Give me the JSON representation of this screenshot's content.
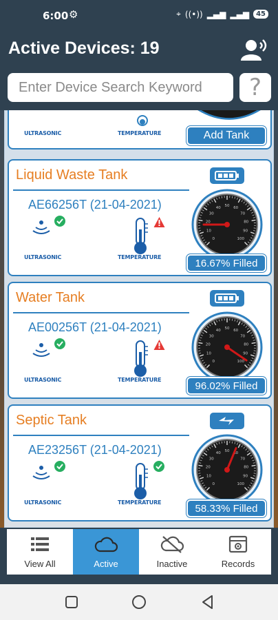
{
  "status_bar": {
    "time": "6:00",
    "battery": "45"
  },
  "header": {
    "title": "Active Devices: 19"
  },
  "search": {
    "placeholder": "Enter Device Search Keyword",
    "help_glyph": "?"
  },
  "sensor_labels": {
    "ultrasonic": "ULTRASONIC",
    "temperature": "TEMPERATURE"
  },
  "partial_card": {
    "button_label": "Add Tank"
  },
  "tanks": [
    {
      "name": "Liquid Waste Tank",
      "device_id": "AE66256T (21-04-2021)",
      "fill_label": "16.67% Filled",
      "fill_percent": 16.67,
      "ultrasonic_status": "ok",
      "temperature_status": "alert",
      "battery": "full"
    },
    {
      "name": "Water Tank",
      "device_id": "AE00256T (21-04-2021)",
      "fill_label": "96.02% Filled",
      "fill_percent": 96.02,
      "ultrasonic_status": "ok",
      "temperature_status": "alert",
      "battery": "full"
    },
    {
      "name": "Septic Tank",
      "device_id": "AE23256T (21-04-2021)",
      "fill_label": "58.33% Filled",
      "fill_percent": 58.33,
      "ultrasonic_status": "ok",
      "temperature_status": "ok",
      "battery": "charging"
    }
  ],
  "bottom_nav": [
    {
      "label": "View All",
      "icon": "list-icon",
      "active": false
    },
    {
      "label": "Active",
      "icon": "cloud-icon",
      "active": true
    },
    {
      "label": "Inactive",
      "icon": "cloud-off-icon",
      "active": false
    },
    {
      "label": "Records",
      "icon": "records-icon",
      "active": false
    }
  ],
  "colors": {
    "accent": "#2e80bf",
    "title_orange": "#e67e22",
    "ok_green": "#27ae60",
    "alert_red": "#e53935",
    "nav_active": "#3a96d6",
    "header_bg": "#2f4150"
  }
}
